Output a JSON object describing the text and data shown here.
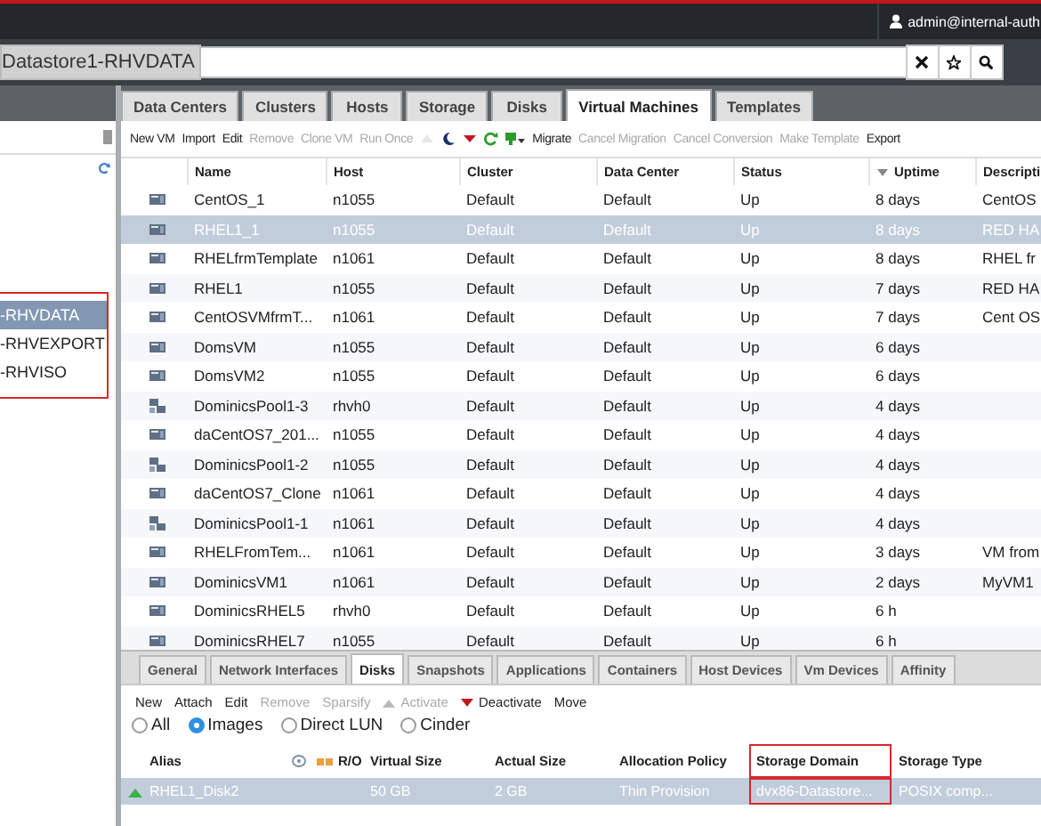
{
  "header": {
    "user": "admin@internal-auth"
  },
  "search": {
    "prefix": "Datastore1-RHVDATA"
  },
  "sidebar": {
    "highlighted": true,
    "items": [
      {
        "label": "-RHVDATA",
        "selected": true
      },
      {
        "label": "-RHVEXPORT",
        "selected": false
      },
      {
        "label": "-RHVISO",
        "selected": false
      }
    ]
  },
  "main_tabs": [
    {
      "label": "Data Centers",
      "selected": false
    },
    {
      "label": "Clusters",
      "selected": false
    },
    {
      "label": "Hosts",
      "selected": false
    },
    {
      "label": "Storage",
      "selected": false
    },
    {
      "label": "Disks",
      "selected": false
    },
    {
      "label": "Virtual Machines",
      "selected": true
    },
    {
      "label": "Templates",
      "selected": false
    }
  ],
  "toolbar": [
    {
      "kind": "text",
      "label": "New VM",
      "disabled": false
    },
    {
      "kind": "text",
      "label": "Import",
      "disabled": false
    },
    {
      "kind": "text",
      "label": "Edit",
      "disabled": false
    },
    {
      "kind": "text",
      "label": "Remove",
      "disabled": true
    },
    {
      "kind": "text",
      "label": "Clone VM",
      "disabled": true
    },
    {
      "kind": "text",
      "label": "Run Once",
      "disabled": true
    },
    {
      "kind": "run",
      "disabled": true
    },
    {
      "kind": "suspend",
      "disabled": false
    },
    {
      "kind": "shutdown",
      "disabled": false
    },
    {
      "kind": "reboot",
      "disabled": false
    },
    {
      "kind": "console",
      "disabled": false
    },
    {
      "kind": "text",
      "label": "Migrate",
      "disabled": false
    },
    {
      "kind": "text",
      "label": "Cancel Migration",
      "disabled": true
    },
    {
      "kind": "text",
      "label": "Cancel Conversion",
      "disabled": true
    },
    {
      "kind": "text",
      "label": "Make Template",
      "disabled": true
    },
    {
      "kind": "text",
      "label": "Export",
      "disabled": false
    }
  ],
  "table": {
    "columns": [
      {
        "label": "Name"
      },
      {
        "label": "Host"
      },
      {
        "label": "Cluster"
      },
      {
        "label": "Data Center"
      },
      {
        "label": "Status"
      },
      {
        "label": "Uptime",
        "sorted": true
      },
      {
        "label": "Descripti"
      }
    ],
    "rows": [
      {
        "kind": "vm",
        "selected": false,
        "cells": [
          "CentOS_1",
          "n1055",
          "Default",
          "Default",
          "Up",
          "8 days",
          "CentOS"
        ]
      },
      {
        "kind": "vm",
        "selected": true,
        "cells": [
          "RHEL1_1",
          "n1055",
          "Default",
          "Default",
          "Up",
          "8 days",
          "RED HA"
        ]
      },
      {
        "kind": "vm",
        "selected": false,
        "cells": [
          "RHELfrmTemplate",
          "n1061",
          "Default",
          "Default",
          "Up",
          "8 days",
          "RHEL fr"
        ]
      },
      {
        "kind": "vm",
        "selected": false,
        "cells": [
          "RHEL1",
          "n1055",
          "Default",
          "Default",
          "Up",
          "7 days",
          "RED HA"
        ]
      },
      {
        "kind": "vm",
        "selected": false,
        "cells": [
          "CentOSVMfrmT...",
          "n1061",
          "Default",
          "Default",
          "Up",
          "7 days",
          "Cent OS"
        ]
      },
      {
        "kind": "vm",
        "selected": false,
        "cells": [
          "DomsVM",
          "n1055",
          "Default",
          "Default",
          "Up",
          "6 days",
          ""
        ]
      },
      {
        "kind": "vm",
        "selected": false,
        "cells": [
          "DomsVM2",
          "n1055",
          "Default",
          "Default",
          "Up",
          "6 days",
          ""
        ]
      },
      {
        "kind": "pool",
        "selected": false,
        "cells": [
          "DominicsPool1-3",
          "rhvh0",
          "Default",
          "Default",
          "Up",
          "4 days",
          ""
        ]
      },
      {
        "kind": "vm",
        "selected": false,
        "cells": [
          "daCentOS7_201...",
          "n1055",
          "Default",
          "Default",
          "Up",
          "4 days",
          ""
        ]
      },
      {
        "kind": "pool",
        "selected": false,
        "cells": [
          "DominicsPool1-2",
          "n1055",
          "Default",
          "Default",
          "Up",
          "4 days",
          ""
        ]
      },
      {
        "kind": "vm",
        "selected": false,
        "cells": [
          "daCentOS7_Clone",
          "n1061",
          "Default",
          "Default",
          "Up",
          "4 days",
          ""
        ]
      },
      {
        "kind": "pool",
        "selected": false,
        "cells": [
          "DominicsPool1-1",
          "n1061",
          "Default",
          "Default",
          "Up",
          "4 days",
          ""
        ]
      },
      {
        "kind": "vm",
        "selected": false,
        "cells": [
          "RHELFromTem...",
          "n1061",
          "Default",
          "Default",
          "Up",
          "3 days",
          "VM from"
        ]
      },
      {
        "kind": "vm",
        "selected": false,
        "cells": [
          "DominicsVM1",
          "n1061",
          "Default",
          "Default",
          "Up",
          "2 days",
          "MyVM1"
        ]
      },
      {
        "kind": "vm",
        "selected": false,
        "cells": [
          "DominicsRHEL5",
          "rhvh0",
          "Default",
          "Default",
          "Up",
          "6 h",
          ""
        ]
      },
      {
        "kind": "vm",
        "selected": false,
        "cells": [
          "DominicsRHEL7",
          "n1055",
          "Default",
          "Default",
          "Up",
          "6 h",
          ""
        ]
      }
    ]
  },
  "detail_tabs": [
    {
      "label": "General",
      "selected": false
    },
    {
      "label": "Network Interfaces",
      "selected": false
    },
    {
      "label": "Disks",
      "selected": true
    },
    {
      "label": "Snapshots",
      "selected": false
    },
    {
      "label": "Applications",
      "selected": false
    },
    {
      "label": "Containers",
      "selected": false
    },
    {
      "label": "Host Devices",
      "selected": false
    },
    {
      "label": "Vm Devices",
      "selected": false
    },
    {
      "label": "Affinity",
      "selected": false
    }
  ],
  "disk_toolbar": [
    {
      "kind": "text",
      "label": "New",
      "disabled": false
    },
    {
      "kind": "text",
      "label": "Attach",
      "disabled": false
    },
    {
      "kind": "text",
      "label": "Edit",
      "disabled": false
    },
    {
      "kind": "text",
      "label": "Remove",
      "disabled": true
    },
    {
      "kind": "text",
      "label": "Sparsify",
      "disabled": true
    },
    {
      "kind": "activate",
      "label": "Activate",
      "disabled": true
    },
    {
      "kind": "deactivate",
      "label": "Deactivate",
      "disabled": false
    },
    {
      "kind": "text",
      "label": "Move",
      "disabled": false
    }
  ],
  "disk_filter": [
    {
      "label": "All",
      "selected": false
    },
    {
      "label": "Images",
      "selected": true
    },
    {
      "label": "Direct LUN",
      "selected": false
    },
    {
      "label": "Cinder",
      "selected": false
    }
  ],
  "disk_table": {
    "columns": [
      {
        "kind": "text",
        "label": "Alias",
        "highlighted": false
      },
      {
        "kind": "bootable",
        "highlighted": false
      },
      {
        "kind": "shareable",
        "highlighted": false
      },
      {
        "kind": "text",
        "label": "R/O",
        "highlighted": false
      },
      {
        "kind": "text",
        "label": "Virtual Size",
        "highlighted": false
      },
      {
        "kind": "text",
        "label": "Actual Size",
        "highlighted": false
      },
      {
        "kind": "text",
        "label": "Allocation Policy",
        "highlighted": false
      },
      {
        "kind": "text",
        "label": "Storage Domain",
        "highlighted": true
      },
      {
        "kind": "text",
        "label": "Storage Type",
        "highlighted": false
      }
    ],
    "rows": [
      {
        "up": true,
        "selected": true,
        "cells": [
          "RHEL1_Disk2",
          "",
          "",
          "",
          "50 GB",
          "2 GB",
          "Thin Provision",
          "dvx86-Datastore...",
          "POSIX comp..."
        ]
      }
    ]
  }
}
